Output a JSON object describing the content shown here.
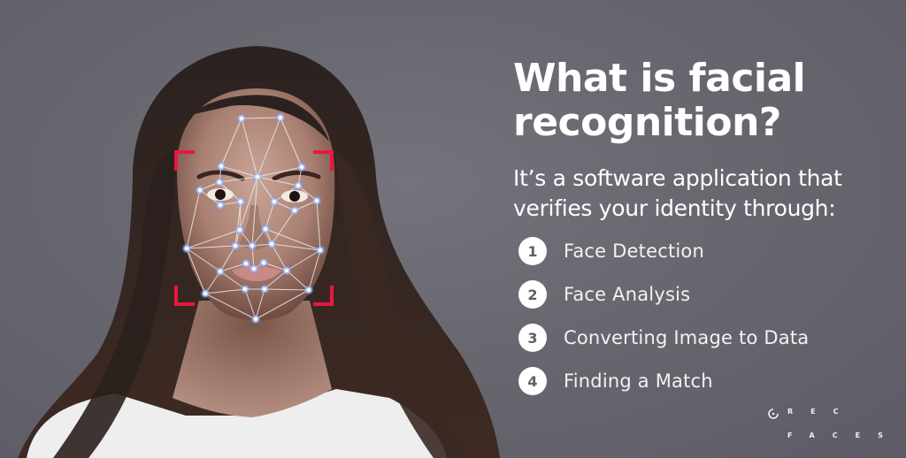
{
  "headline": "What is facial recognition?",
  "subheadline": "It’s a software application that verifies your identity through:",
  "steps": [
    {
      "number": "1",
      "label": "Face Detection"
    },
    {
      "number": "2",
      "label": "Face Analysis"
    },
    {
      "number": "3",
      "label": "Converting Image to Data"
    },
    {
      "number": "4",
      "label": "Finding a Match"
    }
  ],
  "logo": {
    "line1": "REC",
    "line2": "FACES",
    "icon": "circle-dot-icon"
  },
  "colors": {
    "background": "#66656f",
    "text": "#ffffff",
    "bracket": "#e8173f",
    "mesh_line": "#f3ece6",
    "mesh_node": "#9fc4ff",
    "step_number": "#5f5e69"
  },
  "photo": {
    "subject": "woman-portrait-with-face-mesh",
    "icon": "face-mesh-overlay"
  }
}
